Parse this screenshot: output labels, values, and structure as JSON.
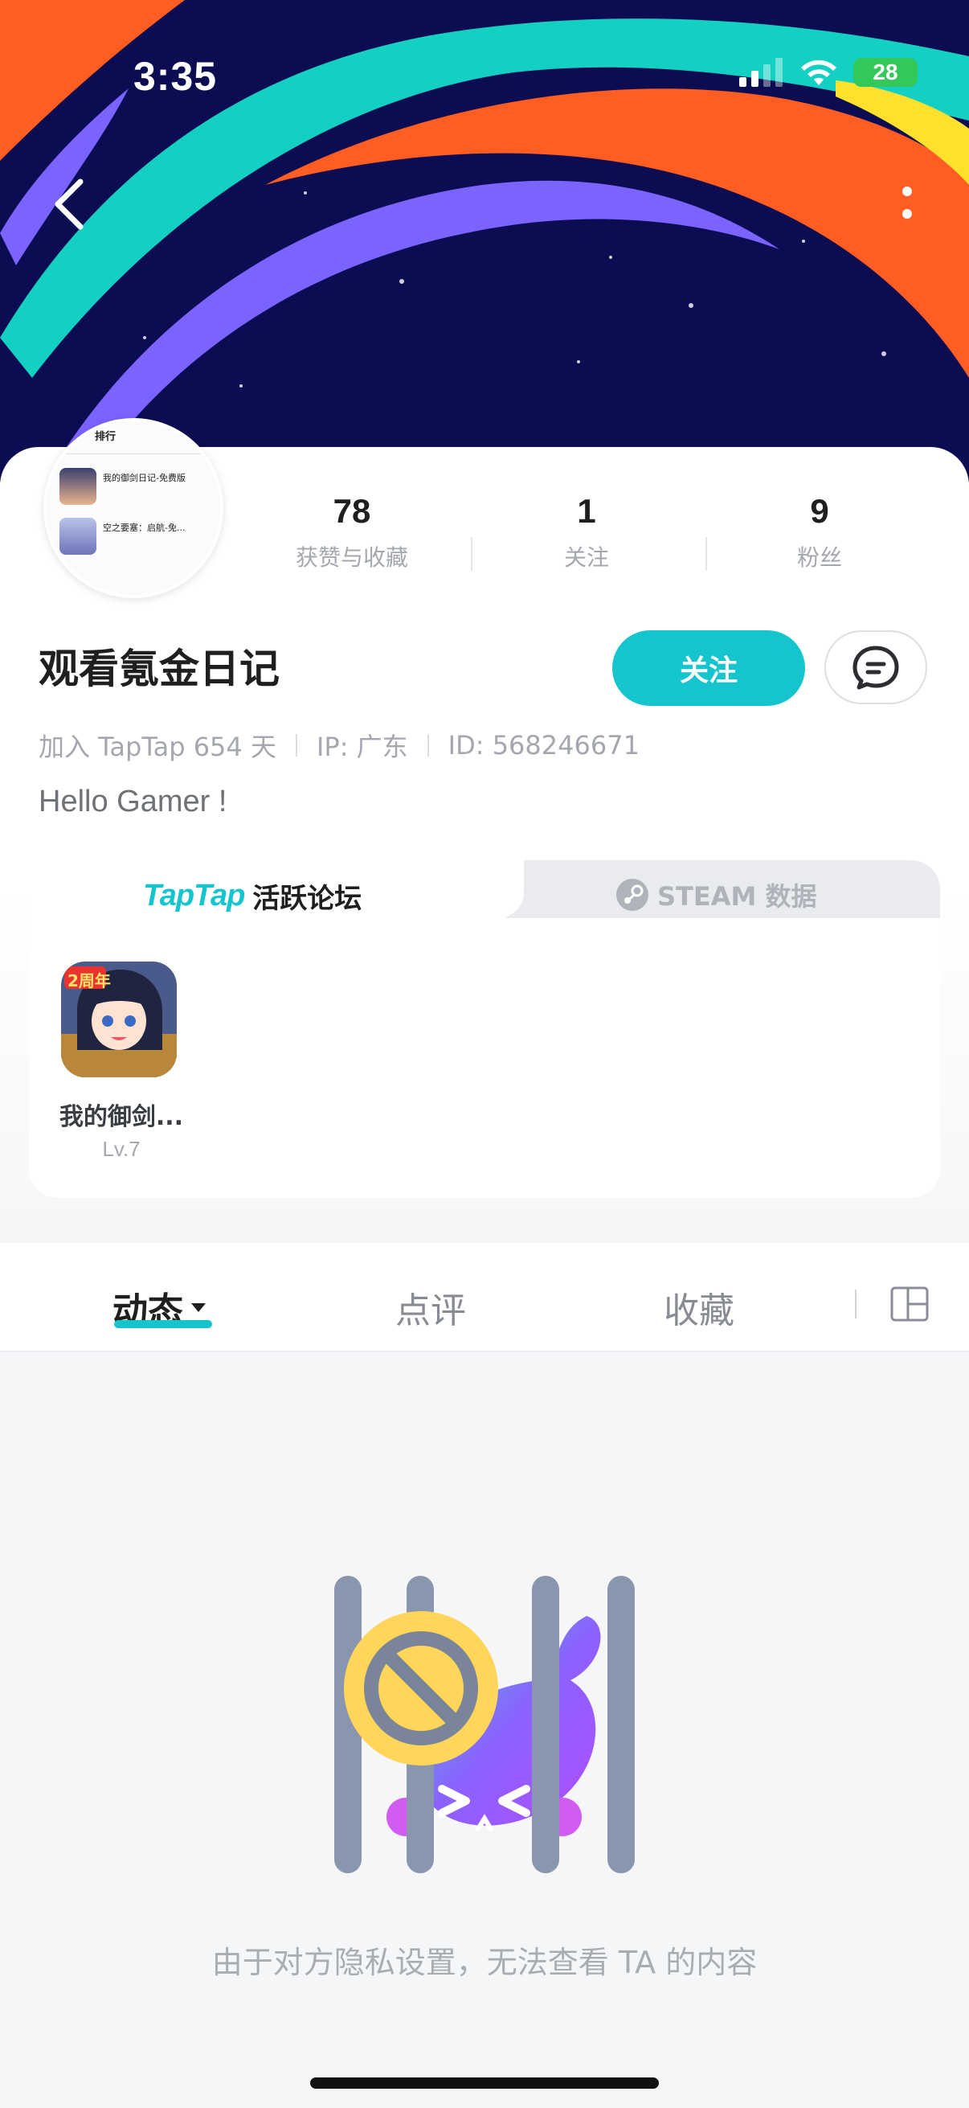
{
  "status_bar": {
    "time": "3:35",
    "battery": "28"
  },
  "profile": {
    "username": "观看氪金日记",
    "stats": [
      {
        "value": "78",
        "label": "获赞与收藏"
      },
      {
        "value": "1",
        "label": "关注"
      },
      {
        "value": "9",
        "label": "粉丝"
      }
    ],
    "follow_label": "关注",
    "meta": {
      "joined": "加入 TapTap 654 天",
      "ip": "IP: 广东",
      "id": "ID: 568246671"
    },
    "bio": "Hello Gamer !"
  },
  "avatar_preview": {
    "header_left": "排行",
    "items": [
      {
        "title": "我的御剑日记-免费版"
      },
      {
        "title": "空之要塞：启航-免..."
      }
    ]
  },
  "forum": {
    "brand": "TapTap",
    "tab_label": "活跃论坛",
    "steam_label": "STEAM 数据",
    "games": [
      {
        "name": "我的御剑...",
        "level": "Lv.7",
        "badge": "2周年"
      }
    ]
  },
  "tabs": {
    "items": [
      "动态",
      "点评",
      "收藏"
    ],
    "active": "动态"
  },
  "empty_state": {
    "message": "由于对方隐私设置，无法查看 TA 的内容"
  },
  "colors": {
    "accent": "#15c5ce",
    "banner_bg": "#0b0c52",
    "orange": "#ff5d22",
    "purple": "#7b63ff"
  }
}
